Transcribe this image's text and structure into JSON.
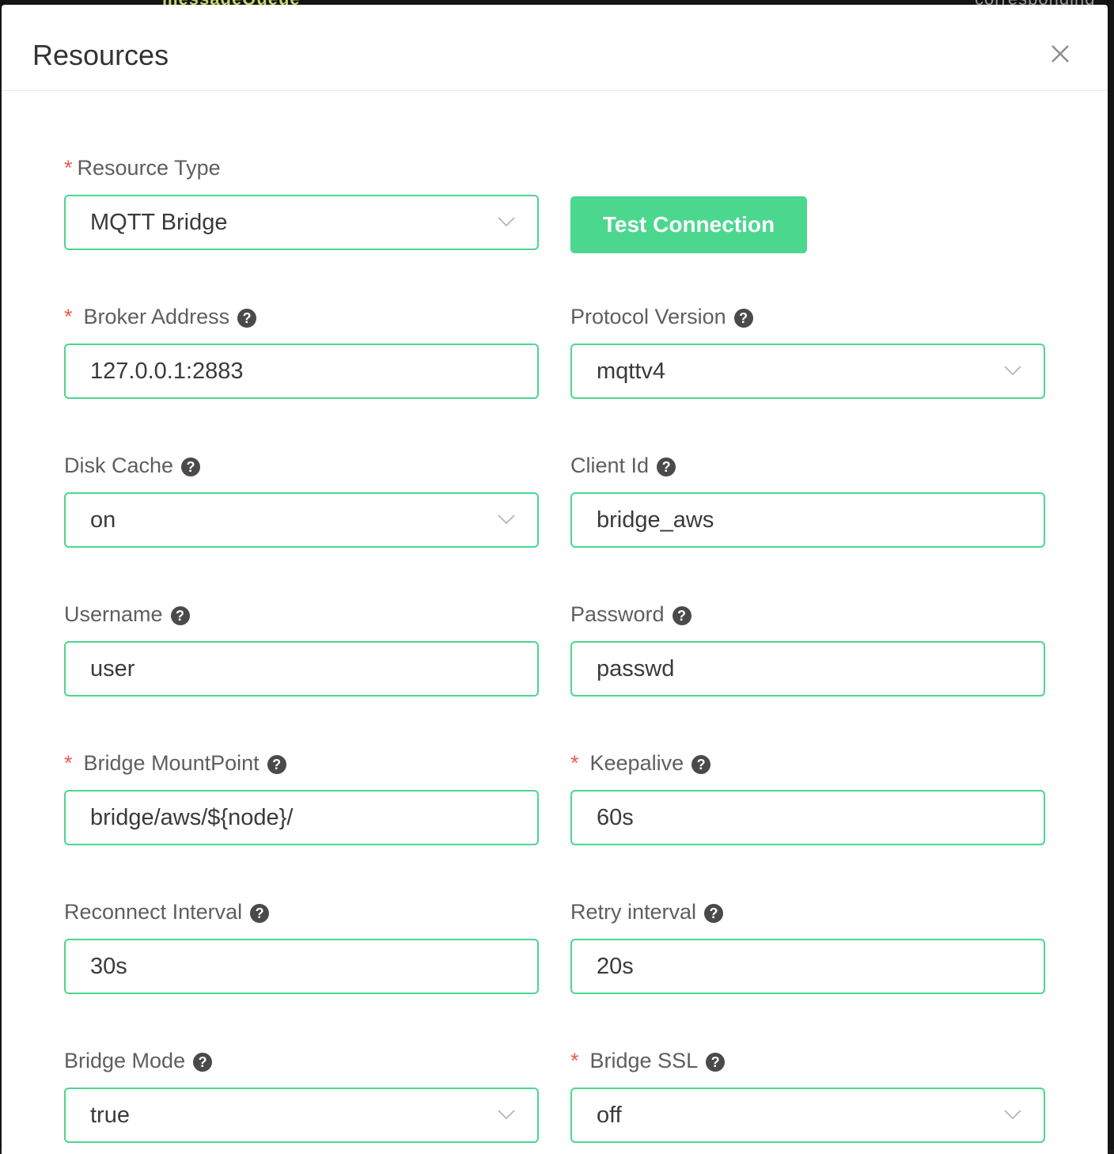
{
  "background": {
    "left_text": "messageQueue",
    "right_text": "corresponding"
  },
  "dialog": {
    "title": "Resources",
    "close_icon": "close-icon"
  },
  "form": {
    "resource_type": {
      "label": "Resource Type",
      "required": "*",
      "value": "MQTT Bridge"
    },
    "test_connection_label": "Test Connection",
    "broker_address": {
      "label": "Broker Address",
      "required": "*",
      "value": "127.0.0.1:2883"
    },
    "protocol_version": {
      "label": "Protocol Version",
      "value": "mqttv4"
    },
    "disk_cache": {
      "label": "Disk Cache",
      "value": "on"
    },
    "client_id": {
      "label": "Client Id",
      "value": "bridge_aws"
    },
    "username": {
      "label": "Username",
      "value": "user"
    },
    "password": {
      "label": "Password",
      "value": "passwd"
    },
    "bridge_mountpoint": {
      "label": "Bridge MountPoint",
      "required": "*",
      "value": "bridge/aws/${node}/"
    },
    "keepalive": {
      "label": "Keepalive",
      "required": "*",
      "value": "60s"
    },
    "reconnect_interval": {
      "label": "Reconnect Interval",
      "value": "30s"
    },
    "retry_interval": {
      "label": "Retry interval",
      "value": "20s"
    },
    "bridge_mode": {
      "label": "Bridge Mode",
      "value": "true"
    },
    "bridge_ssl": {
      "label": "Bridge SSL",
      "required": "*",
      "value": "off"
    }
  },
  "colors": {
    "accent": "#4cd78f",
    "required": "#f05a4a",
    "text": "#5e5e5e"
  },
  "help_glyph": "?"
}
